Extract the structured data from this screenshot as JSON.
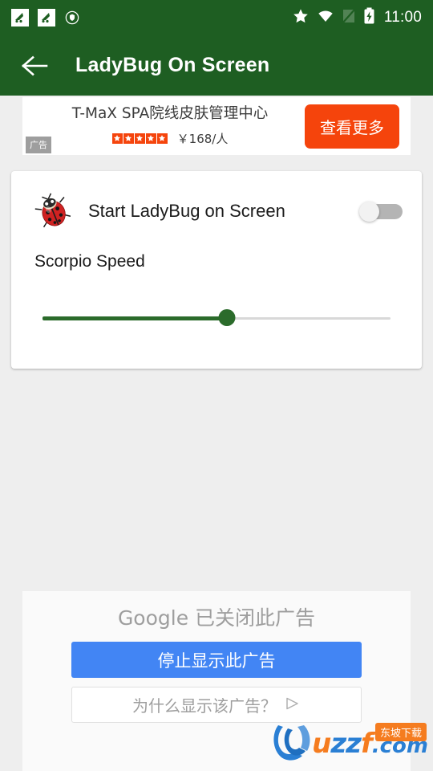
{
  "status_bar": {
    "time": "11:00",
    "left_icons": [
      {
        "name": "notification-tile-icon-1",
        "glyph": "app-notification"
      },
      {
        "name": "notification-tile-icon-2",
        "glyph": "app-notification"
      },
      {
        "name": "shield-security-icon",
        "glyph": "shield"
      }
    ],
    "right_icons": [
      {
        "name": "star-icon",
        "glyph": "star"
      },
      {
        "name": "wifi-icon",
        "glyph": "wifi"
      },
      {
        "name": "signal-icon",
        "glyph": "signal-no-sim"
      },
      {
        "name": "battery-charging-icon",
        "glyph": "battery-bolt"
      }
    ]
  },
  "app_bar": {
    "back_icon": "arrow-left-icon",
    "title": "LadyBug On Screen"
  },
  "top_ad": {
    "headline": "T-MaX SPA院线皮肤管理中心",
    "rating": 5,
    "price": "￥168/人",
    "cta_label": "查看更多",
    "ad_label": "广告",
    "accent_color": "#f5440c"
  },
  "settings_card": {
    "toggle_row": {
      "icon": "ladybug-icon",
      "label": "Start LadyBug on Screen",
      "enabled": false
    },
    "slider": {
      "label": "Scorpio Speed",
      "value_percent": 53,
      "track_color": "#2b6b2b"
    }
  },
  "bottom_ad": {
    "heading_brand": "Google",
    "heading_text": " 已关闭此广告",
    "primary_button": "停止显示此广告",
    "secondary_button": "为什么显示该广告？",
    "adchoices_icon": "adchoices-icon",
    "primary_color": "#4285f4"
  },
  "watermark": {
    "part_u": "u",
    "part_zz": "zz",
    "part_f": "f",
    "domain": ".com",
    "badge": "东坡下载"
  }
}
